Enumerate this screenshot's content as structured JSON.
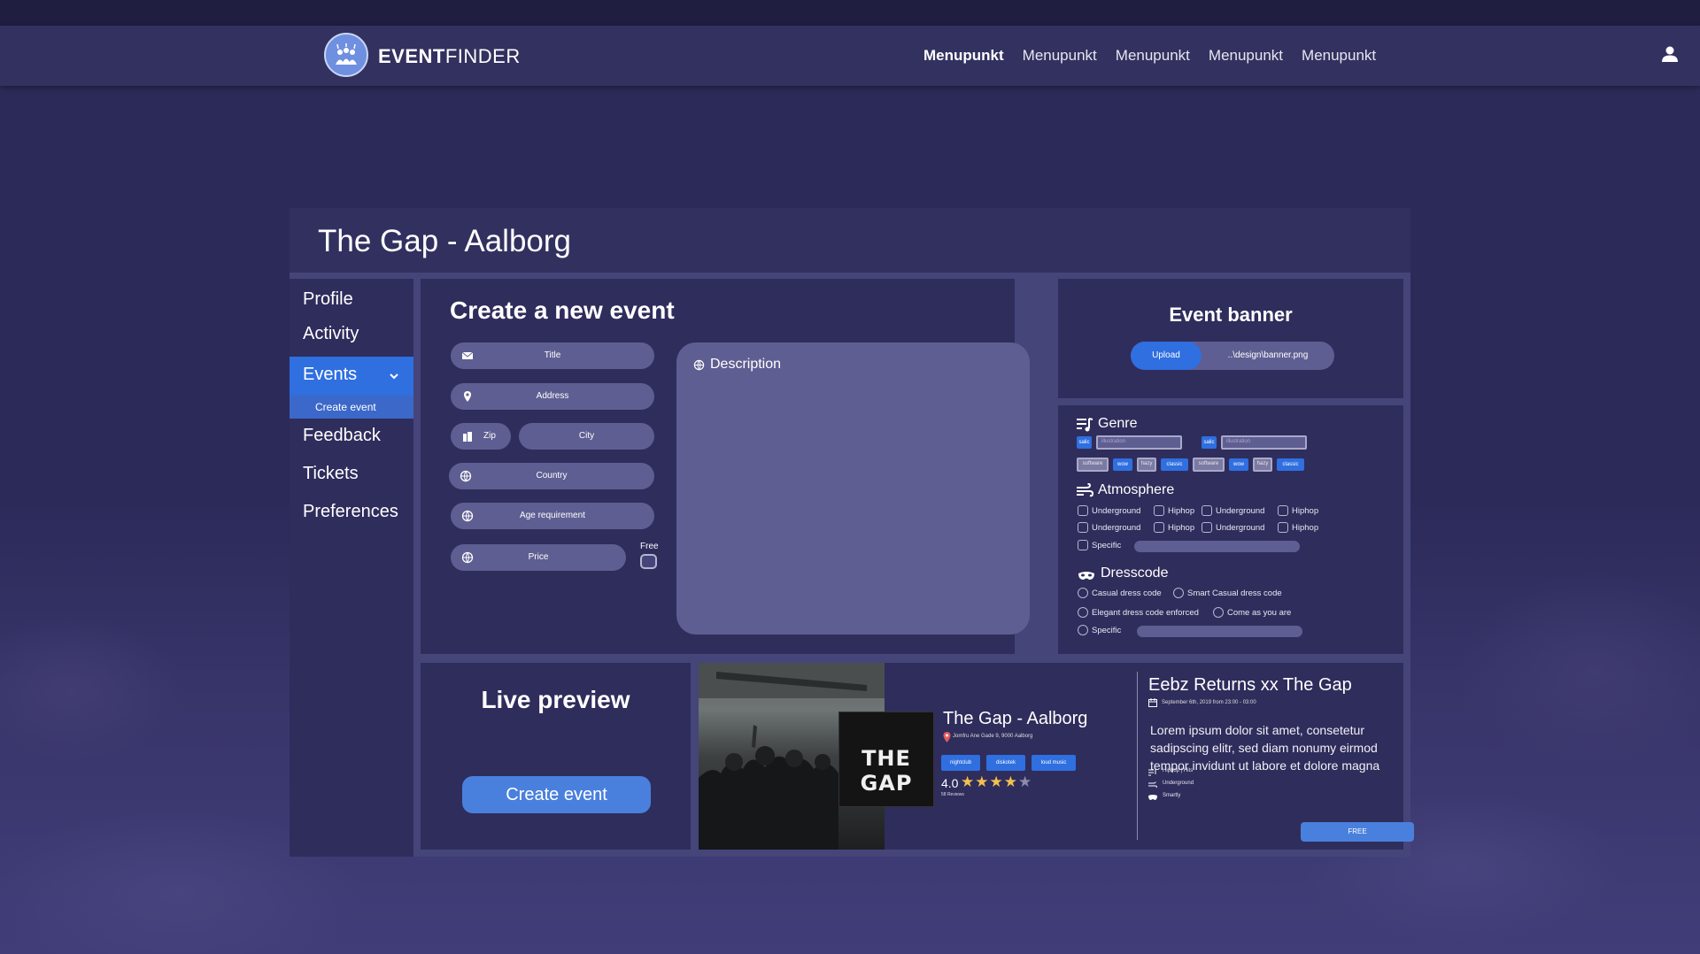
{
  "colors": {
    "accent": "#2f6fe0",
    "panel": "#2f2d5c",
    "background": "#2c2a59",
    "field": "#5f5e92",
    "star": "#f2c14e"
  },
  "navbar": {
    "brand_bold": "EVENT",
    "brand_light": "FINDER",
    "logo_icon": "crowd-logo-icon",
    "items": [
      "Menupunkt",
      "Menupunkt",
      "Menupunkt",
      "Menupunkt",
      "Menupunkt"
    ],
    "user_icon": "user-icon"
  },
  "page": {
    "title": "The Gap - Aalborg"
  },
  "sidebar": {
    "items": [
      "Profile",
      "Activity",
      "Events",
      "Feedback",
      "Tickets",
      "Preferences"
    ],
    "sub_item": "Create event"
  },
  "create": {
    "heading": "Create a new event",
    "fields": {
      "title": "Title",
      "address": "Address",
      "zip": "Zip",
      "city": "City",
      "country": "Country",
      "age": "Age requirement",
      "price": "Price",
      "description": "Description"
    },
    "free_label": "Free"
  },
  "banner": {
    "heading": "Event banner",
    "upload_label": "Upload",
    "file": "..\\design\\banner.png"
  },
  "genre": {
    "heading": "Genre",
    "row1": [
      "salic",
      "illustration",
      "salic",
      "illustration"
    ],
    "row2": [
      "software",
      "wow",
      "hazy",
      "classic",
      "software",
      "wow",
      "hazy",
      "classic"
    ]
  },
  "atmosphere": {
    "heading": "Atmosphere",
    "options": [
      "Underground",
      "Hiphop",
      "Underground",
      "Hiphop",
      "Underground",
      "Hiphop",
      "Underground",
      "Hiphop"
    ],
    "specific": "Specific"
  },
  "dresscode": {
    "heading": "Dresscode",
    "options": [
      "Casual dress code",
      "Smart Casual dress code",
      "Elegant dress code enforced",
      "Come as you are"
    ],
    "specific": "Specific"
  },
  "live": {
    "heading": "Live preview",
    "button": "Create event"
  },
  "preview": {
    "logo_text": "THE GAP",
    "venue": "The Gap - Aalborg",
    "address": "Jomfru Ane Gade 9, 9000 Aalborg",
    "tags": [
      "nightclub",
      "diskotek",
      "loud music"
    ],
    "rating": "4.0",
    "stars_filled": 4,
    "stars_total": 5,
    "reviews": "58 Reviews",
    "event_title": "Eebz Returns xx The Gap",
    "event_date": "September 6th, 2019 from 23:00 - 03:00",
    "event_text": "Lorem ipsum dolor sit amet, consetetur sadipscing elitr, sed diam nonumy eirmod tempor invidunt ut labore et dolore magna",
    "meta": [
      "Hiphop | Hits",
      "Underground",
      "Smartly"
    ],
    "free_button": "FREE"
  }
}
